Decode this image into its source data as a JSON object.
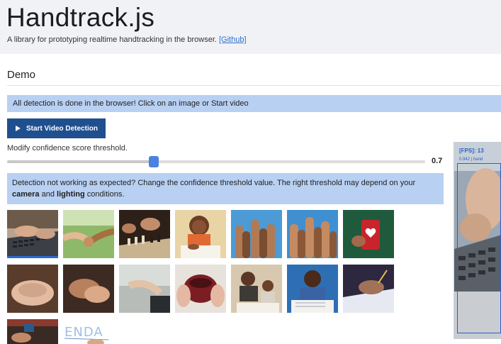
{
  "header": {
    "title": "Handtrack.js",
    "subtitle": "A library for prototyping realtime handtracking in the browser.",
    "github_link": "[Github]"
  },
  "demo": {
    "section_title": "Demo",
    "info_bold": "All detection is done in the browser!",
    "info_text": " Click on an image or Start video",
    "start_button": "Start Video Detection",
    "slider_label": "Modify confidence score threshold.",
    "threshold_value": "0.7",
    "threshold_level": 0.7,
    "warn_part1": "Detection not working as expected? Change the confidence threshold value. The right threshold may depend on your ",
    "warn_camera": "camera",
    "warn_and": " and ",
    "warn_lighting": "lighting",
    "warn_part2": " conditions."
  },
  "video": {
    "fps_label": "[FPS]: 13",
    "detection_label": "0.942  | hand"
  },
  "colors": {
    "header_bg": "#f0f2f6",
    "info_bg": "#b8d0f2",
    "button_bg": "#1f4f8f",
    "accent": "#2b6ad6"
  },
  "images": [
    {
      "name": "typing-laptop",
      "selected": true
    },
    {
      "name": "holding-hands-park",
      "selected": false
    },
    {
      "name": "chess-game",
      "selected": false
    },
    {
      "name": "girl-drawing",
      "selected": false
    },
    {
      "name": "raised-hands",
      "selected": false
    },
    {
      "name": "raised-hands-2",
      "selected": false
    },
    {
      "name": "red-cup",
      "selected": false
    },
    {
      "name": "hands-clasped",
      "selected": false
    },
    {
      "name": "hands-together",
      "selected": false
    },
    {
      "name": "hand-gesture",
      "selected": false
    },
    {
      "name": "holding-mug",
      "selected": false
    },
    {
      "name": "father-son-reading",
      "selected": false
    },
    {
      "name": "boy-writing",
      "selected": false
    },
    {
      "name": "hand-writing",
      "selected": false
    },
    {
      "name": "hands-on-table",
      "selected": false
    },
    {
      "name": "handwriting-enda",
      "selected": false
    }
  ],
  "enda_text": "ENDA"
}
